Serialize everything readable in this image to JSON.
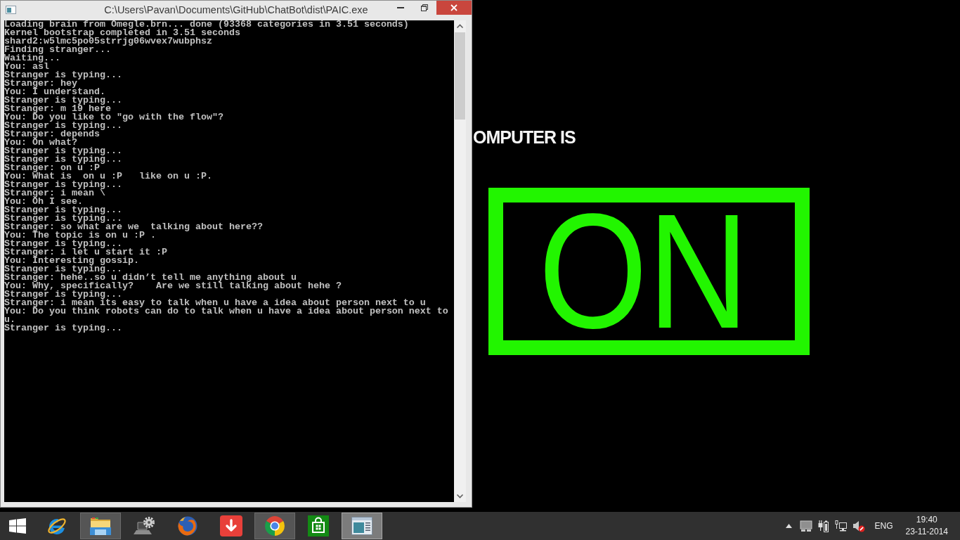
{
  "console_window": {
    "title": "C:\\Users\\Pavan\\Documents\\GitHub\\ChatBot\\dist\\PAIC.exe",
    "lines": [
      "Loading brain from Omegle.brn... done (93368 categories in 3.51 seconds)",
      "Kernel bootstrap completed in 3.51 seconds",
      "shard2:w5lmc5po05strrjg06wvex7wubphsz",
      "Finding stranger...",
      "Waiting...",
      "You: asl",
      "Stranger is typing...",
      "Stranger: hey",
      "You: I understand.",
      "Stranger is typing...",
      "Stranger: m 19 here",
      "You: Do you like to \"go with the flow\"?",
      "Stranger is typing...",
      "Stranger: depends",
      "You: On what?",
      "Stranger is typing...",
      "Stranger is typing...",
      "Stranger: on u :P",
      "You: What is  on u :P   like on u :P.",
      "Stranger is typing...",
      "Stranger: i mean \\",
      "You: Oh I see.",
      "Stranger is typing...",
      "Stranger is typing...",
      "Stranger: so what are we  talking about here??",
      "You: The topic is on u :P .",
      "Stranger is typing...",
      "Stranger: i let u start it :P",
      "You: Interesting gossip.",
      "Stranger is typing...",
      "Stranger: hehe..so u didn’t tell me anything about u",
      "You: Why, specifically?    Are we still talking about hehe ?",
      "Stranger is typing...",
      "Stranger: i mean its easy to talk when u have a idea about person next to u",
      "You: Do you think robots can do to talk when u have a idea about person next to u.",
      "Stranger is typing..."
    ]
  },
  "status_display": {
    "heading": "OMPUTER IS",
    "status": "ON"
  },
  "taskbar": {
    "apps": [
      {
        "kind": "ie",
        "running": false,
        "selected": false
      },
      {
        "kind": "explorer",
        "running": true,
        "selected": false
      },
      {
        "kind": "devices",
        "running": false,
        "selected": false
      },
      {
        "kind": "firefox",
        "running": false,
        "selected": false
      },
      {
        "kind": "download",
        "running": false,
        "selected": false
      },
      {
        "kind": "chrome",
        "running": true,
        "selected": false
      },
      {
        "kind": "store",
        "running": false,
        "selected": false
      },
      {
        "kind": "console",
        "running": true,
        "selected": true
      }
    ],
    "language": "ENG",
    "time": "19:40",
    "date": "23-11-2014"
  }
}
